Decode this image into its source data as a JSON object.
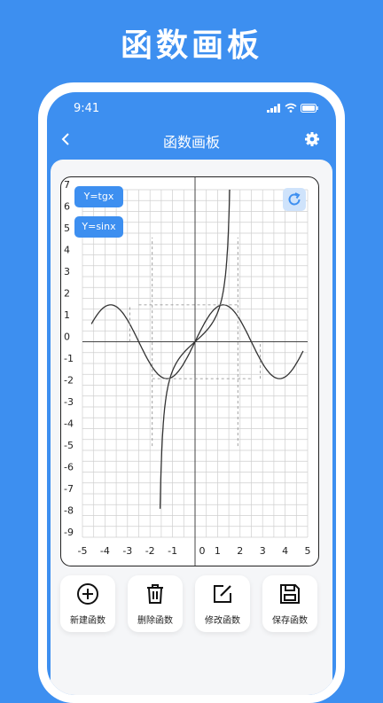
{
  "promo": {
    "title": "函数画板"
  },
  "status_bar": {
    "time": "9:41"
  },
  "nav": {
    "title": "函数画板",
    "back_icon": "chevron-left-icon",
    "settings_icon": "gear-icon"
  },
  "functions": [
    {
      "label": "Y=tgx",
      "expr": "tan"
    },
    {
      "label": "Y=sinx",
      "expr": "sin"
    }
  ],
  "refresh_icon": "refresh-icon",
  "actions": [
    {
      "label": "新建函数",
      "icon": "plus-circle-icon"
    },
    {
      "label": "删除函数",
      "icon": "trash-icon"
    },
    {
      "label": "修改函数",
      "icon": "edit-icon"
    },
    {
      "label": "保存函数",
      "icon": "save-icon"
    }
  ],
  "chart_data": {
    "type": "line",
    "xlim": [
      -5,
      5
    ],
    "ylim": [
      -9,
      7
    ],
    "xticks": [
      -5,
      -4,
      -3,
      -2,
      -1,
      0,
      1,
      2,
      3,
      4,
      5
    ],
    "yticks": [
      7,
      6,
      5,
      4,
      3,
      2,
      1,
      0,
      -1,
      -2,
      -3,
      -4,
      -5,
      -6,
      -7,
      -8,
      -9
    ],
    "grid": true,
    "series": [
      {
        "name": "Y=sinx",
        "function": "sin",
        "amplitude": 1.7,
        "period": 5,
        "x_range": [
          -4.6,
          4.8
        ]
      },
      {
        "name": "Y=tgx",
        "function": "tan",
        "x_range": [
          -1.55,
          1.55
        ]
      }
    ],
    "colors": {
      "curve": "#333333",
      "grid": "#cfcfcf",
      "accent": "#3d8ff0"
    }
  }
}
